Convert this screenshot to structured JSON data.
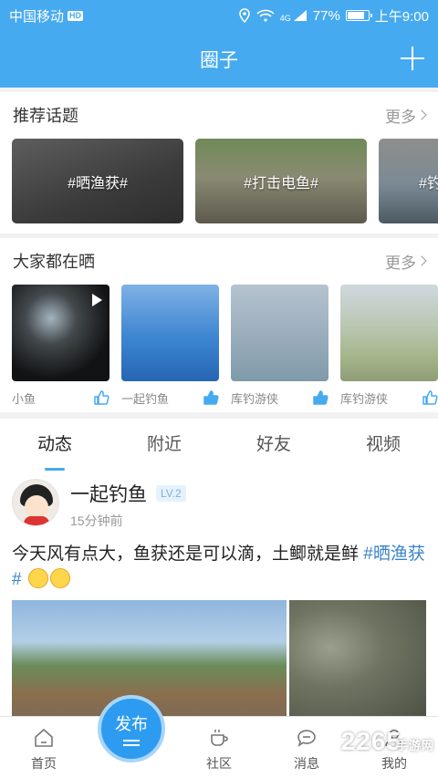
{
  "statusbar": {
    "carrier": "中国移动",
    "hd_badge": "HD",
    "network": "4G",
    "battery": "77%",
    "battery_level": 0.77,
    "time": "上午9:00"
  },
  "appbar": {
    "title": "圈子"
  },
  "topics_section": {
    "title": "推荐话题",
    "more": "更多",
    "items": [
      {
        "label": "#晒渔获#"
      },
      {
        "label": "#打击电鱼#"
      },
      {
        "label": "#钓"
      }
    ]
  },
  "posts_section": {
    "title": "大家都在晒",
    "more": "更多",
    "items": [
      {
        "caption": "小鱼"
      },
      {
        "caption": "一起钓鱼"
      },
      {
        "caption": "库钓游侠"
      },
      {
        "caption": "库钓游侠"
      }
    ]
  },
  "feed": {
    "tabs": [
      "动态",
      "附近",
      "好友",
      "视频"
    ],
    "active_tab": "动态",
    "post": {
      "author": "一起钓鱼",
      "level": "LV.2",
      "time": "15分钟前",
      "text": "今天风有点大，鱼获还是可以滴，土鲫就是鲜",
      "tag": "#晒渔获#"
    }
  },
  "bottom_nav": {
    "home": "首页",
    "publish": "发布",
    "community": "社区",
    "messages": "消息",
    "mine": "我的"
  },
  "watermark": {
    "brand": "2265",
    "sub": "手游网"
  },
  "colors": {
    "primary": "#46aaf0",
    "publish": "#2d9cf0",
    "tag": "#3a83c9"
  }
}
